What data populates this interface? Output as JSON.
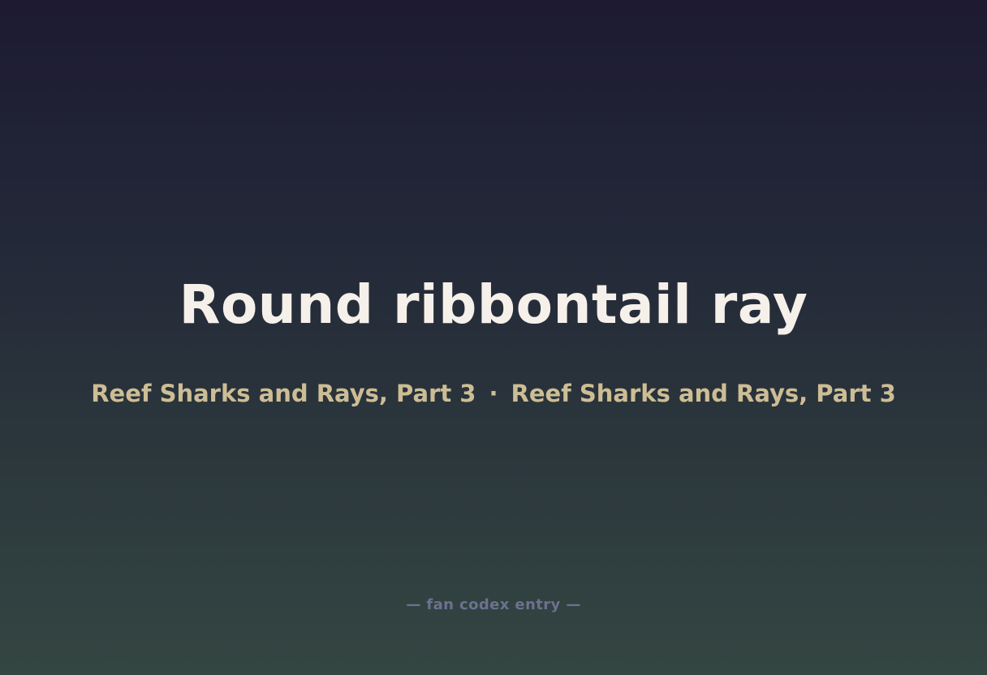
{
  "title": "Round ribbontail ray",
  "subtitle": {
    "left": "Reef Sharks and Rays, Part 3",
    "separator": "·",
    "right": "Reef Sharks and Rays, Part 3"
  },
  "footer": "— fan codex entry —",
  "colors": {
    "title": "#f6f0ea",
    "subtitle": "#cdbd94",
    "footer": "#6c7190",
    "background_top": "#1d1a32",
    "background_bottom": "#344642"
  }
}
